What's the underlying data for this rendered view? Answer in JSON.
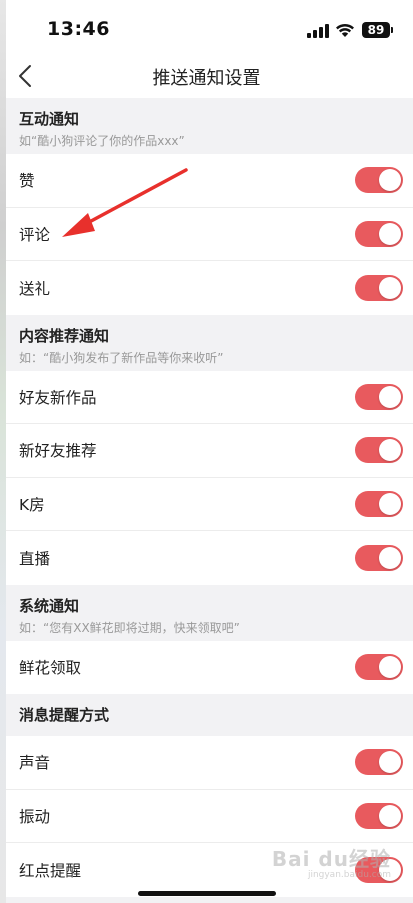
{
  "status_bar": {
    "time": "13:46",
    "battery": "89"
  },
  "nav": {
    "title": "推送通知设置"
  },
  "sections": [
    {
      "title": "互动通知",
      "subtitle": "如“酷小狗评论了你的作品xxx”",
      "items": [
        {
          "label": "赞",
          "on": true
        },
        {
          "label": "评论",
          "on": true
        },
        {
          "label": "送礼",
          "on": true
        }
      ]
    },
    {
      "title": "内容推荐通知",
      "subtitle": "如：“酷小狗发布了新作品等你来收听”",
      "items": [
        {
          "label": "好友新作品",
          "on": true
        },
        {
          "label": "新好友推荐",
          "on": true
        },
        {
          "label": "K房",
          "on": true
        },
        {
          "label": "直播",
          "on": true
        }
      ]
    },
    {
      "title": "系统通知",
      "subtitle": "如：“您有XX鲜花即将过期，快来领取吧”",
      "items": [
        {
          "label": "鲜花领取",
          "on": true
        }
      ]
    },
    {
      "title": "消息提醒方式",
      "subtitle": "",
      "items": [
        {
          "label": "声音",
          "on": true
        },
        {
          "label": "振动",
          "on": true
        },
        {
          "label": "红点提醒",
          "on": true
        }
      ]
    }
  ],
  "colors": {
    "toggle_on": "#e85a5e",
    "annotation_arrow": "#e8302c"
  },
  "watermark": {
    "text": "Bai du经验",
    "url": "jingyan.baidu.com"
  }
}
